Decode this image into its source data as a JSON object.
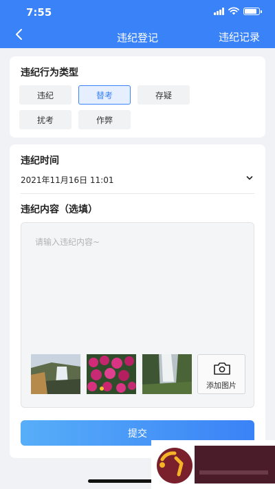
{
  "status_bar": {
    "time": "7:55"
  },
  "nav": {
    "title": "违纪登记",
    "right_action": "违纪记录"
  },
  "violation_type": {
    "title": "违纪行为类型",
    "options": [
      {
        "label": "违纪",
        "selected": false
      },
      {
        "label": "替考",
        "selected": true
      },
      {
        "label": "存疑",
        "selected": false
      },
      {
        "label": "扰考",
        "selected": false
      },
      {
        "label": "作弊",
        "selected": false
      }
    ]
  },
  "violation_time": {
    "title": "违纪时间",
    "value": "2021年11月16日  11:01"
  },
  "violation_content": {
    "title": "违纪内容（选填）",
    "placeholder": "请输入违纪内容~",
    "add_photo_label": "添加图片"
  },
  "submit_label": "提交",
  "colors": {
    "primary": "#3a82f7",
    "background": "#f1f2f6"
  }
}
